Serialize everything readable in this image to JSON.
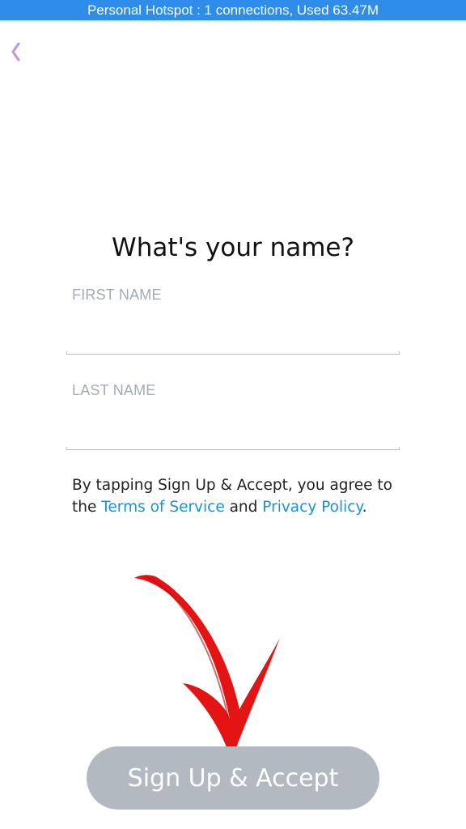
{
  "status_bar": {
    "text": "Personal Hotspot : 1 connections, Used 63.47M",
    "color": "#2f8ce8"
  },
  "header": {
    "back_icon": "chevron-left-icon",
    "back_color": "#c39ad9"
  },
  "main": {
    "title": "What's your name?",
    "first_name": {
      "label": "FIRST NAME",
      "value": ""
    },
    "last_name": {
      "label": "LAST NAME",
      "value": ""
    },
    "terms": {
      "prefix": "By tapping Sign Up & Accept, you agree to the ",
      "terms_link": "Terms of Service",
      "middle": " and ",
      "privacy_link": "Privacy Policy",
      "suffix": ".",
      "link_color": "#1a92d6"
    },
    "annotation_icon": "red-arrow-down-icon",
    "signup_button": {
      "label": "Sign Up & Accept",
      "color": "#b3b9c0"
    }
  }
}
